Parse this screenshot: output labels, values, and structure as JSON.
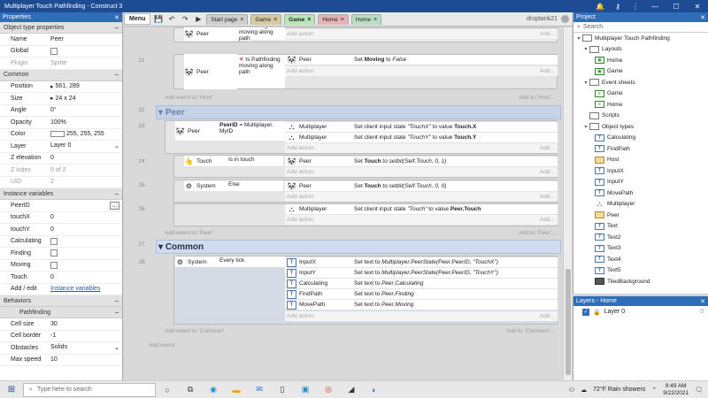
{
  "window": {
    "title": "Multiplayer Touch Pathfinding - Construct 3"
  },
  "props": {
    "title": "Properties",
    "section1": "Object type properties",
    "rows1": [
      {
        "name": "Name",
        "value": "Peer"
      },
      {
        "name": "Global",
        "value": ""
      },
      {
        "name": "Plugin",
        "value": "Sprite"
      }
    ],
    "section2": "Common",
    "position": {
      "name": "Position",
      "value": "561, 289"
    },
    "size": {
      "name": "Size",
      "value": "24 x 24"
    },
    "angle": {
      "name": "Angle",
      "value": "0°"
    },
    "opacity": {
      "name": "Opacity",
      "value": "100%"
    },
    "color": {
      "name": "Color",
      "value": "255, 255, 255"
    },
    "layer": {
      "name": "Layer",
      "value": "Layer 0"
    },
    "zelev": {
      "name": "Z elevation",
      "value": "0"
    },
    "zindex": {
      "name": "Z index",
      "value": "0 of 2"
    },
    "uid": {
      "name": "UID",
      "value": "2"
    },
    "section3": "Instance variables",
    "vars": [
      {
        "name": "PeerID",
        "value": ""
      },
      {
        "name": "touchX",
        "value": "0"
      },
      {
        "name": "touchY",
        "value": "0"
      },
      {
        "name": "Calculating",
        "value": ""
      },
      {
        "name": "Finding",
        "value": ""
      },
      {
        "name": "Moving",
        "value": ""
      },
      {
        "name": "Touch",
        "value": "0"
      }
    ],
    "addedit": {
      "name": "Add / edit",
      "value": "Instance variables"
    },
    "section4": "Behaviors",
    "behavior": "Pathfinding",
    "brows": [
      {
        "name": "Cell size",
        "value": "30"
      },
      {
        "name": "Cell border",
        "value": "-1"
      },
      {
        "name": "Obstacles",
        "value": "Solids"
      },
      {
        "name": "Max speed",
        "value": "10"
      }
    ]
  },
  "toolbar": {
    "menu": "Menu",
    "tabs": [
      {
        "label": "Start page",
        "color": "#cfcfcf"
      },
      {
        "label": "Game",
        "color": "#d9c9a3"
      },
      {
        "label": "Game",
        "color": "#b8e6b8"
      },
      {
        "label": "Home",
        "color": "#e3b3b8"
      },
      {
        "label": "Home",
        "color": "#b8dcc4"
      }
    ],
    "user": "droptank21"
  },
  "sheet": {
    "e20": {
      "obj": "Peer",
      "cond": "Pathfinding moving along path",
      "addaction": "Add action"
    },
    "e21": {
      "num": "21",
      "cond1obj": "Peer",
      "cond1": "Is  Pathfinding moving along path",
      "actobj": "Peer",
      "act_pre": "Set ",
      "act_b": "Moving",
      "act_mid": " to ",
      "act_i": "False",
      "addaction": "Add action"
    },
    "addevent_host": "Add event to 'Host'",
    "addto_host": "Add to 'Host'...",
    "g22": {
      "num": "22",
      "name": "Peer"
    },
    "e23": {
      "num": "23",
      "obj": "Peer",
      "cond_b": "PeerID",
      "cond_rest": " = Multiplayer. MyID",
      "a1obj": "Multiplayer",
      "a1pre": "Set client input state ",
      "a1i": "\"TouchX\"",
      "a1mid": " to value ",
      "a1b": "Touch.X",
      "a2obj": "Multiplayer",
      "a2pre": "Set client input state ",
      "a2i": "\"TouchY\"",
      "a2mid": " to value ",
      "a2b": "Touch.Y",
      "addaction": "Add action"
    },
    "e24": {
      "num": "24",
      "obj": "Touch",
      "cond": "Is in touch",
      "aobj": "Peer",
      "apre": "Set ",
      "ab": "Touch",
      "amid": " to ",
      "ai": "setbit(Self.Touch, 0, 1)",
      "addaction": "Add action"
    },
    "e25": {
      "num": "25",
      "obj": "System",
      "cond": "Else",
      "aobj": "Peer",
      "apre": "Set ",
      "ab": "Touch",
      "amid": " to ",
      "ai": "setbit(Self.Touch, 0, 0)",
      "addaction": "Add action"
    },
    "e26": {
      "num": "26",
      "aobj": "Multiplayer",
      "apre": "Set client input state ",
      "ai": "\"Touch\"",
      "amid": " to value ",
      "ab": "Peer.Touch",
      "addaction": "Add action"
    },
    "addevent_peer": "Add event to 'Peer'",
    "addto_peer": "Add to 'Peer'...",
    "g27": {
      "num": "27",
      "name": "Common"
    },
    "e28": {
      "num": "28",
      "obj": "System",
      "cond": "Every tick",
      "actions": [
        {
          "obj": "InputX",
          "pre": "Set text to ",
          "i": "Multiplayer.PeerState(Peer.PeerID, \"TouchX\")"
        },
        {
          "obj": "InputY",
          "pre": "Set text to ",
          "i": "Multiplayer.PeerState(Peer.PeerID, \"TouchY\")"
        },
        {
          "obj": "Calculating",
          "pre": "Set text to ",
          "i": "Peer.Calculating"
        },
        {
          "obj": "FindPath",
          "pre": "Set text to ",
          "i": "Peer.Finding"
        },
        {
          "obj": "MovePath",
          "pre": "Set text to ",
          "i": "Peer.Moving"
        }
      ],
      "addaction": "Add action"
    },
    "addevent_common": "Add event to 'Common'",
    "addto_common": "Add to 'Common'...",
    "addevent": "Add event"
  },
  "project": {
    "title": "Project",
    "search": "Search",
    "root": "Multiplayer Touch Pathfinding",
    "layouts": "Layouts",
    "layout_items": [
      "Home",
      "Game"
    ],
    "eventsheets": "Event sheets",
    "sheet_items": [
      "Game",
      "Home"
    ],
    "scripts": "Scripts",
    "objecttypes": "Object types",
    "objects": [
      {
        "name": "Calculating",
        "icon": "text"
      },
      {
        "name": "FindPath",
        "icon": "text"
      },
      {
        "name": "Host",
        "icon": "sprite"
      },
      {
        "name": "InputX",
        "icon": "text"
      },
      {
        "name": "InputY",
        "icon": "text"
      },
      {
        "name": "MovePath",
        "icon": "text"
      },
      {
        "name": "Multiplayer",
        "icon": "multiplayer"
      },
      {
        "name": "Peer",
        "icon": "sprite"
      },
      {
        "name": "Text",
        "icon": "text"
      },
      {
        "name": "Text2",
        "icon": "text"
      },
      {
        "name": "Text3",
        "icon": "text"
      },
      {
        "name": "Text4",
        "icon": "text"
      },
      {
        "name": "Text5",
        "icon": "text"
      },
      {
        "name": "TiledBackground",
        "icon": "tiled"
      }
    ]
  },
  "layers": {
    "title": "Layers - Home",
    "layer": "Layer 0",
    "count": "0"
  },
  "taskbar": {
    "search": "Type here to search",
    "weather": "72°F  Rain showers",
    "time": "9:49 AM",
    "date": "9/22/2021"
  }
}
